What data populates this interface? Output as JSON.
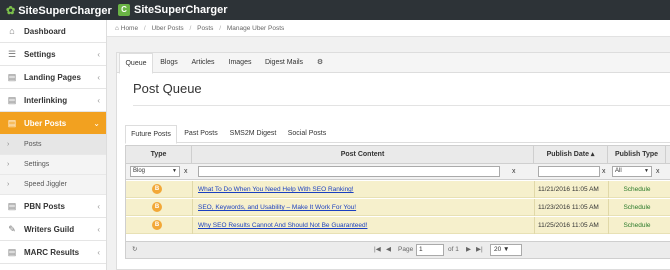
{
  "brand": {
    "name": "SiteSuperCharger"
  },
  "header": {
    "app_letter": "C",
    "app_title": "SiteSuperCharger"
  },
  "sidebar": {
    "items": [
      {
        "label": "Dashboard",
        "icon": "home-icon",
        "glyph": "⌂"
      },
      {
        "label": "Settings",
        "icon": "settings-icon",
        "glyph": "☰",
        "chevron": "‹"
      },
      {
        "label": "Landing Pages",
        "icon": "landing-pages-icon",
        "glyph": "▤",
        "chevron": "‹"
      },
      {
        "label": "Interlinking",
        "icon": "link-icon",
        "glyph": "▤",
        "chevron": "‹"
      },
      {
        "label": "Uber Posts",
        "icon": "uber-posts-icon",
        "glyph": "▤",
        "chevron": "⌄"
      }
    ],
    "sub_items": [
      "Posts",
      "Settings",
      "Speed Jiggler"
    ],
    "items_after": [
      {
        "label": "PBN Posts",
        "icon": "pbn-posts-icon",
        "glyph": "▤",
        "chevron": "‹"
      },
      {
        "label": "Writers Guild",
        "icon": "writers-guild-icon",
        "glyph": "✎",
        "chevron": "‹"
      },
      {
        "label": "MARC Results",
        "icon": "marc-results-icon",
        "glyph": "▤",
        "chevron": "‹"
      }
    ]
  },
  "breadcrumb": {
    "home": "Home",
    "items": [
      "Uber Posts",
      "Posts",
      "Manage Uber Posts"
    ]
  },
  "tabs": [
    "Queue",
    "Blogs",
    "Articles",
    "Images",
    "Digest Mails"
  ],
  "page_title": "Post Queue",
  "subtabs": [
    "Future Posts",
    "Past Posts",
    "SMS2M Digest",
    "Social Posts"
  ],
  "grid": {
    "columns": {
      "type": "Type",
      "content": "Post Content",
      "date": "Publish Date",
      "ptype": "Publish Type"
    },
    "filters": {
      "type_value": "Blog",
      "ptype_value": "All",
      "clear": "x"
    },
    "rows": [
      {
        "badge": "B",
        "content": "What To Do When You Need Help With SEO Ranking!",
        "date": "11/21/2016 11:05 AM",
        "ptype": "Schedule"
      },
      {
        "badge": "B",
        "content": "SEO, Keywords, and Usability – Make It Work For You!",
        "date": "11/23/2016 11:05 AM",
        "ptype": "Schedule"
      },
      {
        "badge": "B",
        "content": "Why SEO Results Cannot And Should Not Be Guaranteed!",
        "date": "11/25/2016 11:05 AM",
        "ptype": "Schedule"
      }
    ],
    "pager": {
      "page_label": "Page",
      "page_value": "1",
      "of_label": "of 1",
      "page_size": "20"
    }
  },
  "colors": {
    "accent": "#f2a120",
    "topbar": "#2d3337",
    "row_highlight": "#f6f0cc",
    "link": "#1a3fc0"
  }
}
